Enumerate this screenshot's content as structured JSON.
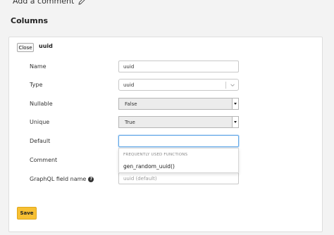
{
  "header": {
    "add_comment_label": "Add a comment",
    "columns_title": "Columns"
  },
  "column": {
    "close_label": "Close",
    "name": "uuid"
  },
  "form": {
    "labels": {
      "name": "Name",
      "type": "Type",
      "nullable": "Nullable",
      "unique": "Unique",
      "default": "Default",
      "comment": "Comment",
      "graphql_field_name": "GraphQL field name"
    },
    "name_value": "uuid",
    "type_value": "uuid",
    "nullable_value": "False",
    "unique_value": "True",
    "default_value": "",
    "graphql_placeholder": "uuid (default)"
  },
  "dropdown": {
    "header": "FREQUENTLY USED FUNCTIONS",
    "items": [
      "gen_random_uuid()"
    ]
  },
  "actions": {
    "save_label": "Save"
  },
  "colors": {
    "save_button": "#f7c033",
    "focus_border": "#66aae8",
    "card_border": "#dedede"
  },
  "icons": {
    "pencil": "pencil-icon",
    "help": "help-icon",
    "chevron": "chevron-down-icon"
  }
}
